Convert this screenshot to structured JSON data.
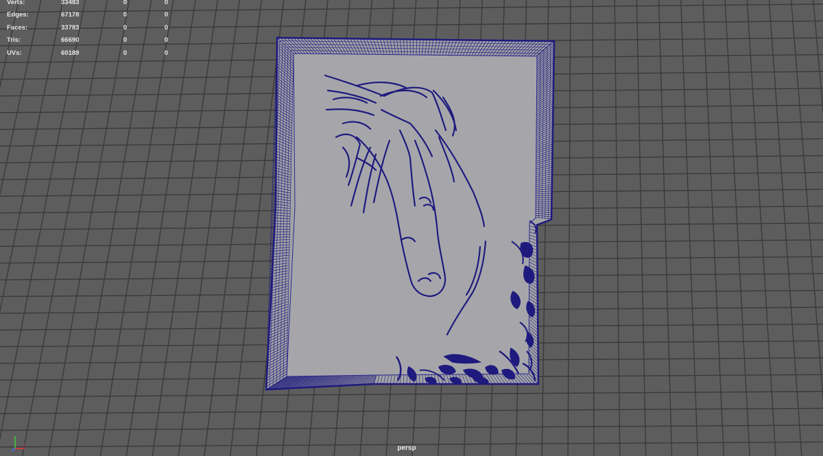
{
  "hud": {
    "rows": [
      {
        "label": "Verts:",
        "total": "33483",
        "selected": "0",
        "selected2": "0"
      },
      {
        "label": "Edges:",
        "total": "67178",
        "selected": "0",
        "selected2": "0"
      },
      {
        "label": "Faces:",
        "total": "33783",
        "selected": "0",
        "selected2": "0"
      },
      {
        "label": "Tris:",
        "total": "66690",
        "selected": "0",
        "selected2": "0"
      },
      {
        "label": "UVs:",
        "total": "60189",
        "selected": "0",
        "selected2": "0"
      }
    ]
  },
  "viewport": {
    "camera": "persp"
  },
  "colors": {
    "background": "#5d5d5d",
    "grid": "#3a3a3a",
    "mesh_fill": "#a3a3a6",
    "wire": "#1e1a7e",
    "hud_text": "#e6e6e6"
  }
}
